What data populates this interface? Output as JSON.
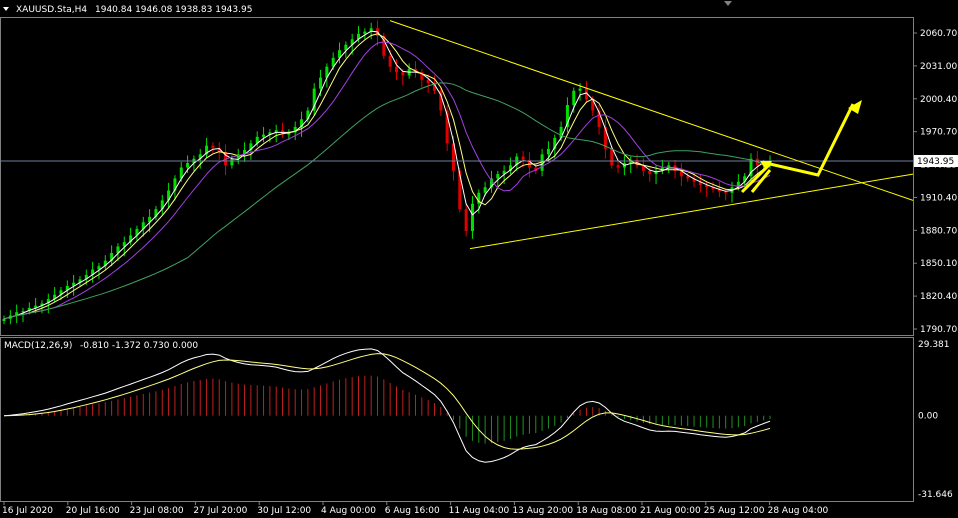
{
  "header": {
    "symbol_label": "XAUUSD.Sta,H4",
    "ohlc_text": "1940.84 1946.08 1938.83 1943.95"
  },
  "macd_header": {
    "label": "MACD(12,26,9)",
    "values_text": "-0.810 -1.372 0.730 0.000"
  },
  "colors": {
    "background": "#000000",
    "bull": "#00e000",
    "bear": "#e00000",
    "ma_fast": "#ffffff",
    "ma_mid": "#ffff80",
    "ma_slow": "#a040e0",
    "ma_long": "#40a060",
    "trendline": "#ffff00",
    "arrow": "#ffff00",
    "price_line": "#7080a0",
    "axis_text": "#ffffff",
    "hist_pos": "#c02020",
    "hist_neg": "#209020"
  },
  "price_axis": {
    "ticks": [
      "2060.70",
      "2031.00",
      "2000.40",
      "1970.70",
      "1940.25",
      "1910.40",
      "1880.70",
      "1850.10",
      "1820.40",
      "1790.70"
    ],
    "current_price_label": "1943.95"
  },
  "macd_axis": {
    "ticks": [
      "29.381",
      "0.00",
      "-31.646"
    ]
  },
  "time_axis": {
    "ticks": [
      "16 Jul 2020",
      "20 Jul 16:00",
      "23 Jul 08:00",
      "27 Jul 20:00",
      "30 Jul 12:00",
      "4 Aug 00:00",
      "6 Aug 16:00",
      "11 Aug 04:00",
      "13 Aug 20:00",
      "18 Aug 08:00",
      "21 Aug 00:00",
      "25 Aug 12:00",
      "28 Aug 04:00"
    ]
  },
  "chart_data": {
    "type": "candlestick",
    "symbol": "XAUUSD.Sta",
    "timeframe": "H4",
    "price_range": [
      1787,
      2080
    ],
    "current_price": 1943.95,
    "last_bar": {
      "open": 1940.84,
      "high": 1946.08,
      "low": 1938.83,
      "close": 1943.95
    },
    "close_series": [
      1800,
      1803,
      1806,
      1807,
      1810,
      1812,
      1814,
      1818,
      1822,
      1826,
      1830,
      1833,
      1836,
      1840,
      1845,
      1848,
      1853,
      1860,
      1866,
      1870,
      1876,
      1882,
      1888,
      1893,
      1900,
      1908,
      1917,
      1928,
      1938,
      1942,
      1946,
      1950,
      1958,
      1956,
      1952,
      1940,
      1946,
      1950,
      1954,
      1960,
      1966,
      1968,
      1970,
      1972,
      1968,
      1970,
      1975,
      1982,
      1990,
      2010,
      2020,
      2030,
      2038,
      2045,
      2050,
      2055,
      2060,
      2062,
      2065,
      2058,
      2040,
      2030,
      2025,
      2022,
      2028,
      2025,
      2018,
      2015,
      2008,
      1990,
      1960,
      1935,
      1900,
      1880,
      1905,
      1915,
      1920,
      1928,
      1932,
      1935,
      1940,
      1948,
      1945,
      1938,
      1935,
      1950,
      1955,
      1965,
      1975,
      1995,
      2008,
      2010,
      2000,
      1990,
      1975,
      1955,
      1940,
      1938,
      1942,
      1945,
      1940,
      1935,
      1932,
      1935,
      1938,
      1940,
      1935,
      1930,
      1928,
      1925,
      1922,
      1920,
      1918,
      1916,
      1915,
      1920,
      1925,
      1930,
      1946,
      1940,
      1942,
      1944
    ],
    "macd": {
      "name": "MACD(12,26,9)",
      "values": [
        -0.81,
        -1.372,
        0.73,
        0.0
      ],
      "range": [
        -31.646,
        29.381
      ]
    },
    "trendlines": [
      {
        "from": {
          "time": "6 Aug 16:00",
          "price": 2072
        },
        "to": {
          "time": "28 Aug 04:00",
          "price": 1922
        }
      },
      {
        "from": {
          "time": "11 Aug 04:00",
          "price": 1864
        },
        "to": {
          "time": "28 Aug 04:00",
          "price": 1926
        }
      }
    ],
    "forecast_arrows": true
  }
}
